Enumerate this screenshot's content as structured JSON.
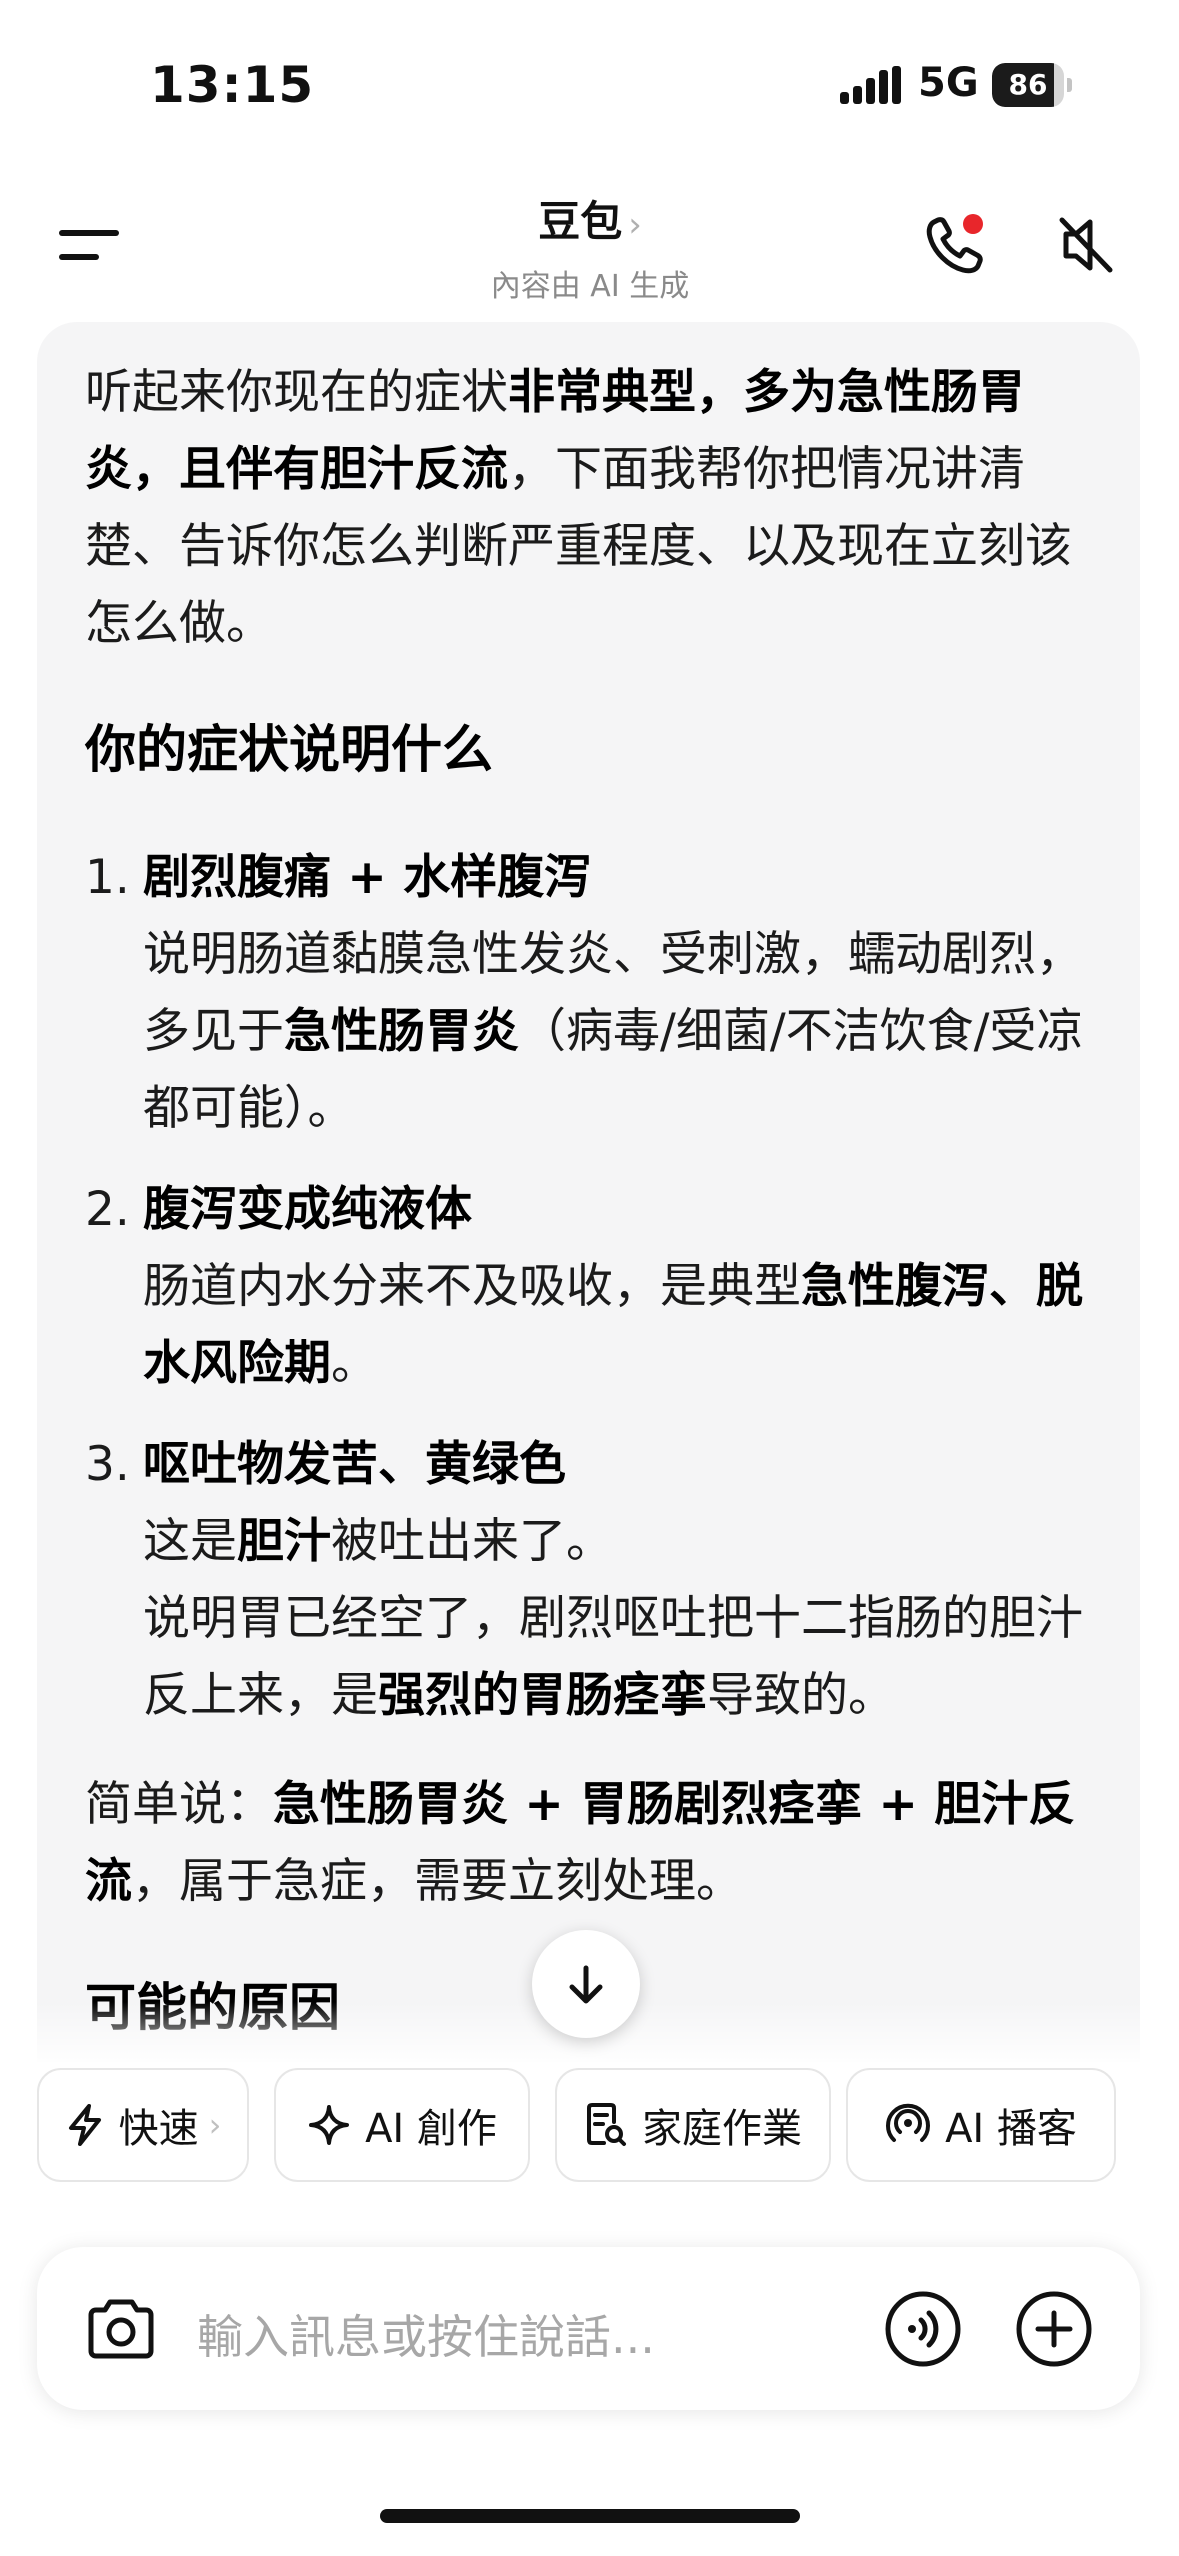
{
  "status_bar": {
    "time": "13:15",
    "network": "5G",
    "battery": "86",
    "battery_level": 0.86
  },
  "header": {
    "title": "豆包",
    "subtitle": "內容由 AI 生成"
  },
  "chat": {
    "intro": [
      {
        "t": "听起来你现在的症状"
      },
      {
        "t": "非常典型，多为急性肠胃炎，且伴有胆汁反流",
        "b": true
      },
      {
        "t": "，下面我帮你把情况讲清楚、告诉你怎么判断严重程度、以及现在立刻该怎么做。"
      }
    ],
    "heading1": "你的症状说明什么",
    "items": [
      {
        "num": "1.",
        "title": "剧烈腹痛 + 水样腹泻",
        "body": [
          [
            {
              "t": "说明肠道黏膜急性发炎、受刺激，蠕动剧烈，多见于"
            },
            {
              "t": "急性肠胃炎",
              "b": true
            },
            {
              "t": "（病毒/细菌/不洁饮食/受凉都可能）。"
            }
          ]
        ]
      },
      {
        "num": "2.",
        "title": "腹泻变成纯液体",
        "body": [
          [
            {
              "t": "肠道内水分来不及吸收，是典型"
            },
            {
              "t": "急性腹泻、脱水风险期",
              "b": true
            },
            {
              "t": "。"
            }
          ]
        ]
      },
      {
        "num": "3.",
        "title": "呕吐物发苦、黄绿色",
        "body": [
          [
            {
              "t": "这是"
            },
            {
              "t": "胆汁",
              "b": true
            },
            {
              "t": "被吐出来了。"
            }
          ],
          [
            {
              "t": "说明胃已经空了，剧烈呕吐把十二指肠的胆汁反上来，是"
            },
            {
              "t": "强烈的胃肠痉挛",
              "b": true
            },
            {
              "t": "导致的。"
            }
          ]
        ]
      }
    ],
    "summary": [
      {
        "t": "简单说："
      },
      {
        "t": "急性肠胃炎 + 胃肠剧烈痉挛 + 胆汁反流",
        "b": true
      },
      {
        "t": "，属于急症，需要立刻处理。"
      }
    ],
    "heading2": "可能的原因"
  },
  "chips": [
    {
      "label": "快速",
      "icon": "lightning-icon",
      "chevron": "›"
    },
    {
      "label": "AI 創作",
      "icon": "sparkle-icon"
    },
    {
      "label": "家庭作業",
      "icon": "homework-search-icon"
    },
    {
      "label": "AI 播客",
      "icon": "podcast-icon"
    }
  ],
  "input": {
    "placeholder": "輸入訊息或按住說話..."
  },
  "colors": {
    "accent_red": "#e8262b",
    "card_bg": "#f5f5f6",
    "text": "#111111",
    "muted": "#8a8a8a"
  }
}
